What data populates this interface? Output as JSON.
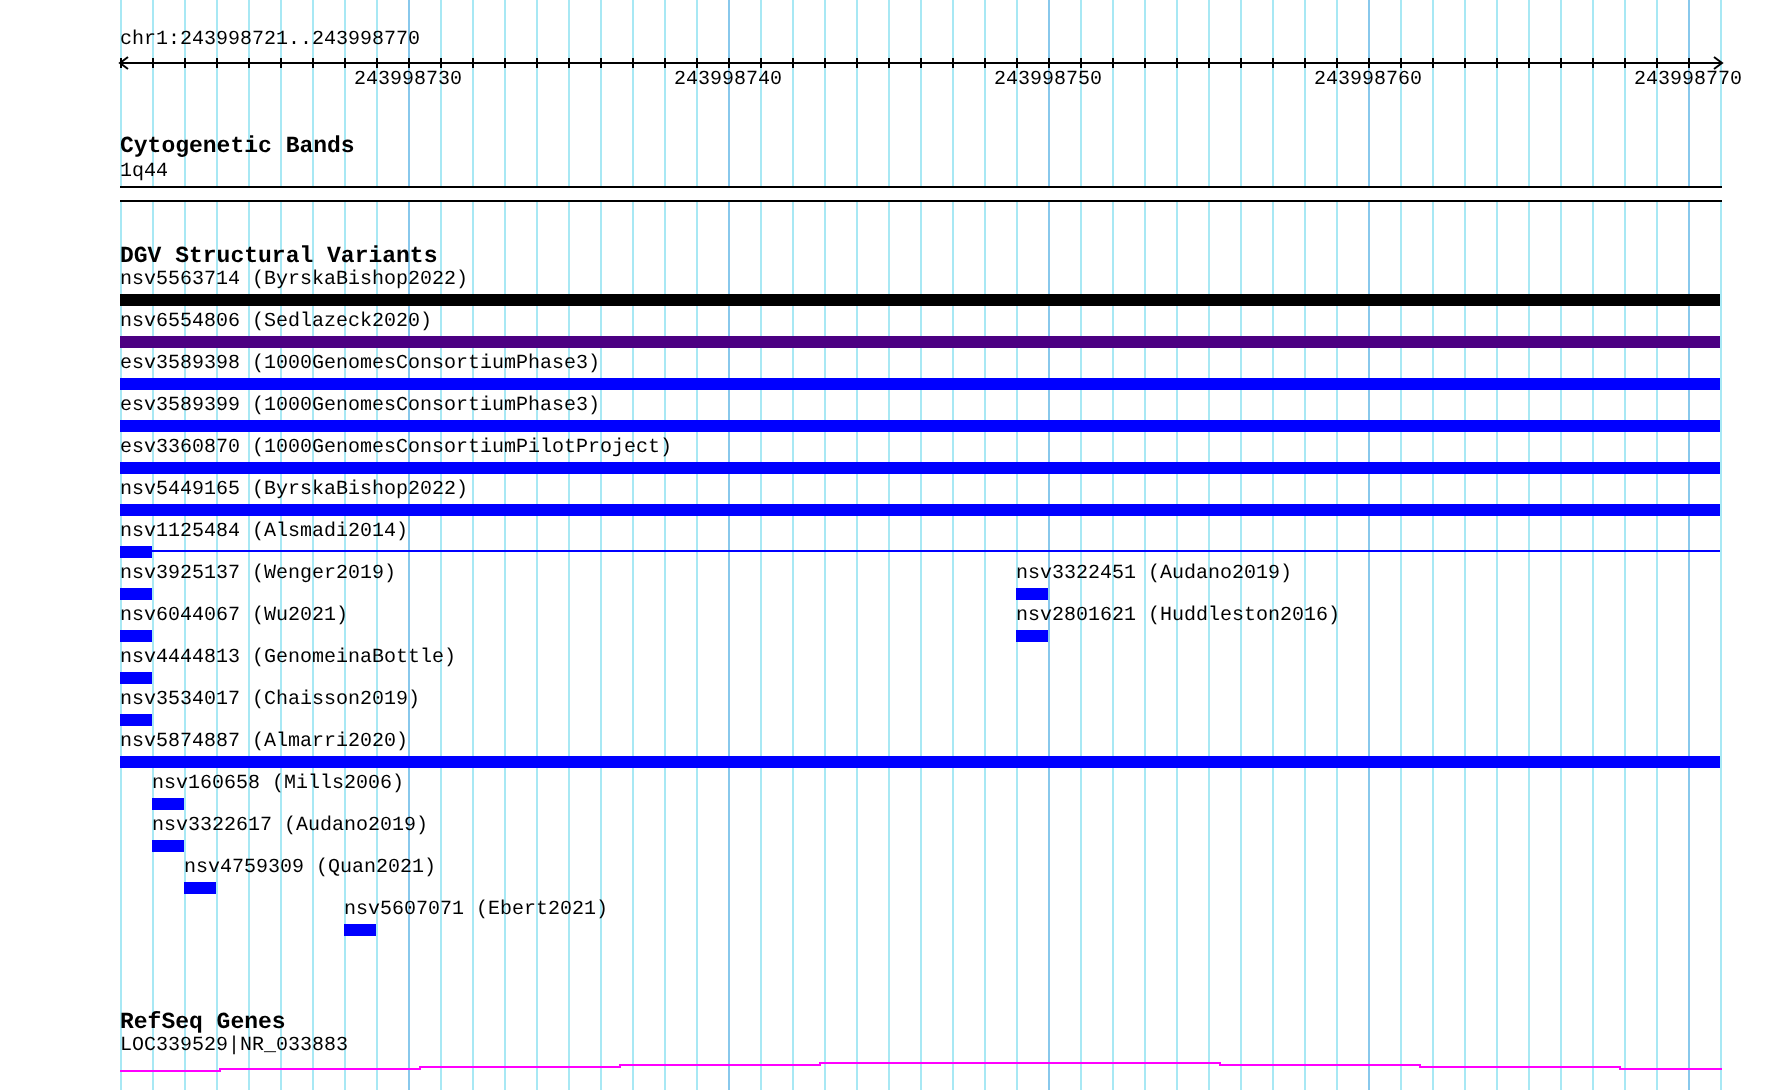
{
  "position": "chr1:243998721..243998770",
  "ruler": {
    "labels": [
      "243998730",
      "243998740",
      "243998750",
      "243998760",
      "243998770"
    ]
  },
  "tracks": [
    {
      "kind": "bands",
      "title": "Cytogenetic Bands",
      "features": [
        {
          "label": "1q44"
        }
      ]
    },
    {
      "kind": "variants",
      "title": "DGV Structural Variants",
      "rows": [
        [
          {
            "kind": "full",
            "label": "nsv5563714 (ByrskaBishop2022)",
            "color": "#000000"
          }
        ],
        [
          {
            "kind": "full",
            "label": "nsv6554806 (Sedlazeck2020)",
            "color": "#4b0082"
          }
        ],
        [
          {
            "kind": "full",
            "label": "esv3589398 (1000GenomesConsortiumPhase3)",
            "color": "#0000ff"
          }
        ],
        [
          {
            "kind": "full",
            "label": "esv3589399 (1000GenomesConsortiumPhase3)",
            "color": "#0000ff"
          }
        ],
        [
          {
            "kind": "full",
            "label": "esv3360870 (1000GenomesConsortiumPilotProject)",
            "color": "#0000ff"
          }
        ],
        [
          {
            "kind": "full",
            "label": "nsv5449165 (ByrskaBishop2022)",
            "color": "#0000ff"
          }
        ],
        [
          {
            "kind": "short-with-line",
            "label": "nsv1125484 (Alsmadi2014)",
            "color": "#0000ff"
          }
        ],
        [
          {
            "kind": "short",
            "label": "nsv3925137 (Wenger2019)",
            "color": "#0000ff"
          },
          {
            "kind": "short",
            "label": "nsv3322451 (Audano2019)",
            "color": "#0000ff"
          }
        ],
        [
          {
            "kind": "short",
            "label": "nsv6044067 (Wu2021)",
            "color": "#0000ff"
          },
          {
            "kind": "short",
            "label": "nsv2801621 (Huddleston2016)",
            "color": "#0000ff"
          }
        ],
        [
          {
            "kind": "short",
            "label": "nsv4444813 (GenomeinaBottle)",
            "color": "#0000ff"
          }
        ],
        [
          {
            "kind": "short",
            "label": "nsv3534017 (Chaisson2019)",
            "color": "#0000ff"
          }
        ],
        [
          {
            "kind": "full",
            "label": "nsv5874887 (Almarri2020)",
            "color": "#0000ff"
          }
        ],
        [
          {
            "kind": "short",
            "label": "nsv160658 (Mills2006)",
            "color": "#0000ff"
          }
        ],
        [
          {
            "kind": "short",
            "label": "nsv3322617 (Audano2019)",
            "color": "#0000ff"
          }
        ],
        [
          {
            "kind": "short",
            "label": "nsv4759309 (Quan2021)",
            "color": "#0000ff"
          }
        ],
        [
          {
            "kind": "short",
            "label": "nsv5607071 (Ebert2021)",
            "color": "#0000ff"
          }
        ]
      ]
    },
    {
      "kind": "genes",
      "title": "RefSeq Genes",
      "features": [
        {
          "label": "LOC339529|NR_033883"
        }
      ]
    }
  ]
}
